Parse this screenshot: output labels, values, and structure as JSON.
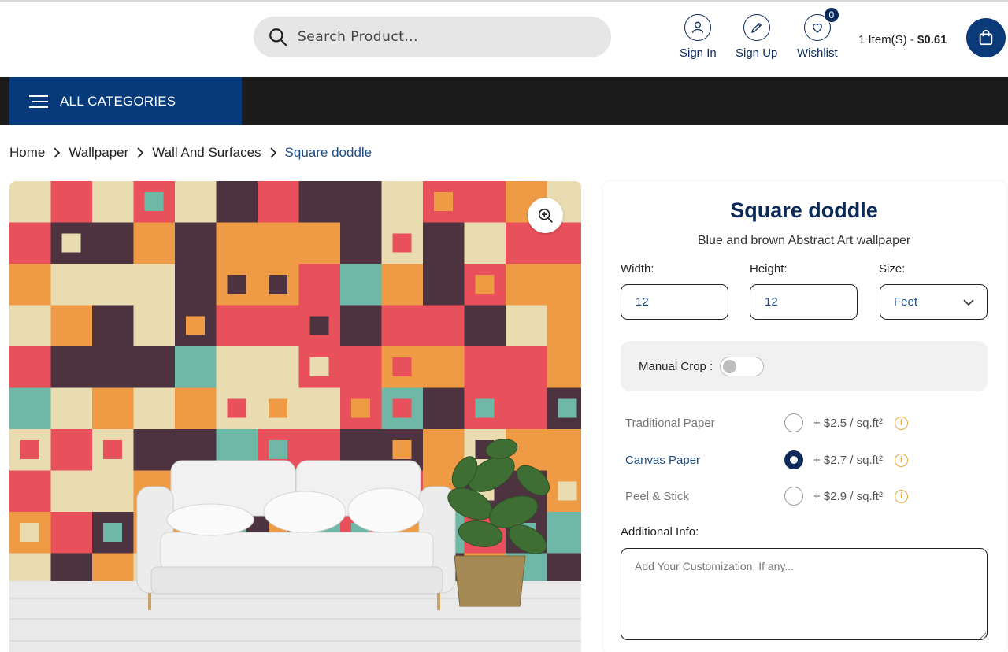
{
  "search": {
    "placeholder": "Search Product..."
  },
  "account": {
    "signin_label": "Sign In",
    "signup_label": "Sign Up",
    "wishlist_label": "Wishlist",
    "wishlist_count": "0"
  },
  "cart": {
    "items_text": "1 Item(S) - ",
    "total": "$0.61"
  },
  "nav": {
    "all_categories_label": "ALL CATEGORIES"
  },
  "breadcrumb": [
    "Home",
    "Wallpaper",
    "Wall And Surfaces",
    "Square doddle"
  ],
  "product": {
    "title": "Square doddle",
    "subtitle": "Blue and brown Abstract Art wallpaper",
    "width_label": "Width:",
    "width_value": "12",
    "height_label": "Height:",
    "height_value": "12",
    "size_label": "Size:",
    "size_value": "Feet",
    "manual_crop_label": "Manual Crop :",
    "manual_crop_on": false,
    "options": [
      {
        "name": "Traditional Paper",
        "price": "+ $2.5 / sq.ft²",
        "selected": false
      },
      {
        "name": "Canvas Paper",
        "price": "+ $2.7 / sq.ft²",
        "selected": true
      },
      {
        "name": "Peel & Stick",
        "price": "+ $2.9 / sq.ft²",
        "selected": false
      }
    ],
    "additional_info_label": "Additional Info:",
    "additional_info_placeholder": "Add Your Customization, If any..."
  },
  "colors": {
    "brand_navy": "#0b2a5a",
    "nav_blue": "#063a7a",
    "nav_dark": "#1c1c1c",
    "accent_info": "#e8a73a"
  },
  "icons": [
    "search-icon",
    "user-icon",
    "pencil-icon",
    "heart-icon",
    "shopping-bag-icon",
    "menu-icon",
    "chevron-right-icon",
    "zoom-in-icon",
    "chevron-down-icon",
    "info-icon"
  ]
}
